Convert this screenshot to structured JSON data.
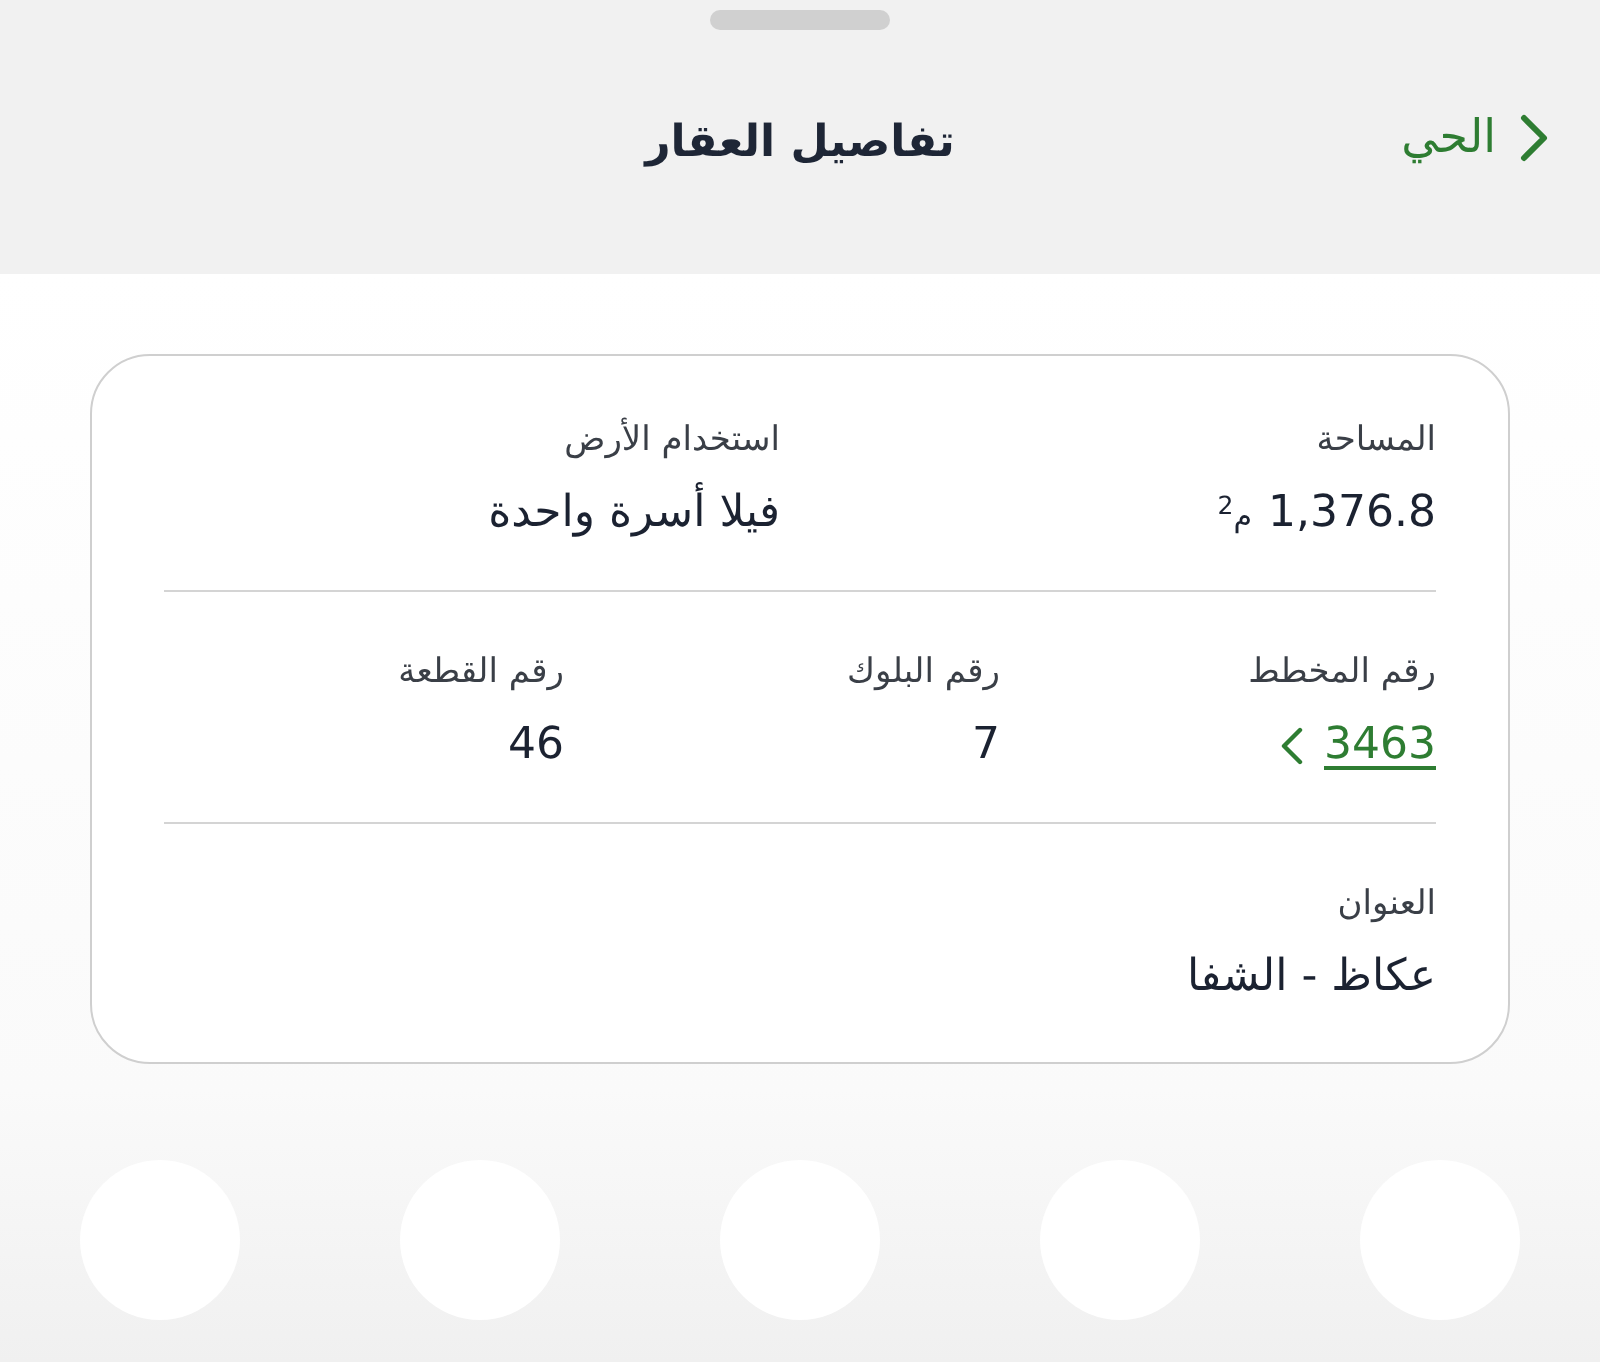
{
  "sheet": {
    "title": "تفاصيل العقار",
    "back": {
      "label": "الحي"
    }
  },
  "sections": [
    {
      "fields": [
        {
          "kind": "area",
          "label": "المساحة",
          "value": "1,376.8",
          "unit": "م$^{2}$"
        },
        {
          "kind": "text",
          "label": "استخدام الأرض",
          "value": "فيلا أسرة واحدة"
        }
      ]
    },
    {
      "fields": [
        {
          "kind": "link",
          "label": "رقم المخطط",
          "value": "3463"
        },
        {
          "kind": "text",
          "label": "رقم البلوك",
          "value": "7"
        },
        {
          "kind": "text",
          "label": "رقم القطعة",
          "value": "46"
        }
      ]
    },
    {
      "fields": [
        {
          "kind": "text",
          "label": "العنوان",
          "value": "عكاظ - الشفا"
        }
      ]
    }
  ]
}
